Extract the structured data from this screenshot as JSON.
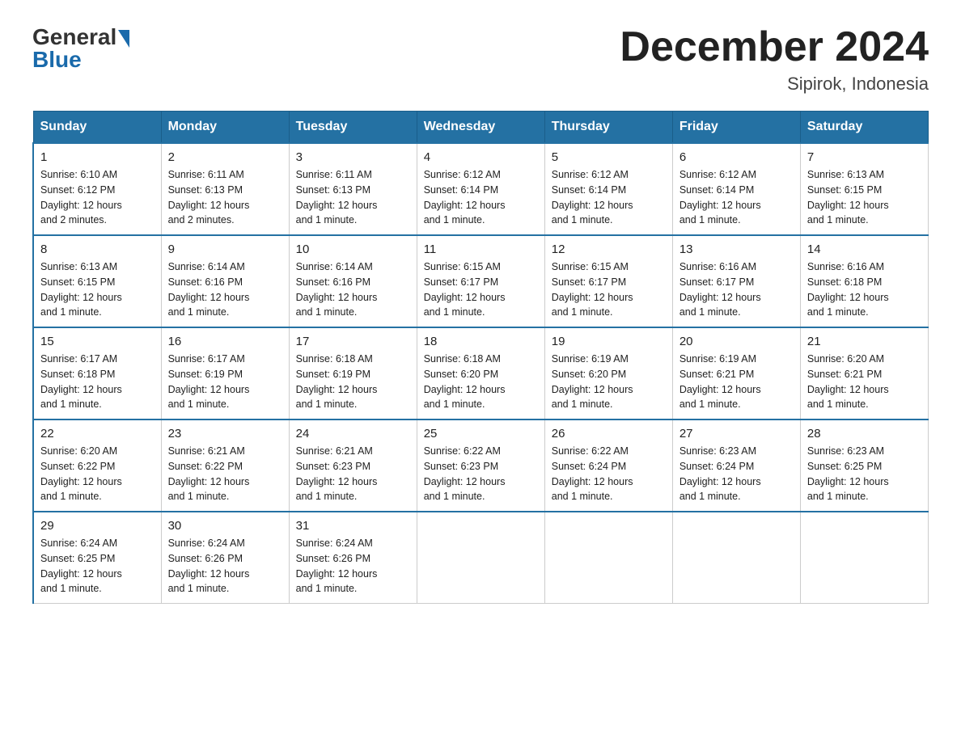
{
  "header": {
    "logo_general": "General",
    "logo_blue": "Blue",
    "month_title": "December 2024",
    "location": "Sipirok, Indonesia"
  },
  "days_of_week": [
    "Sunday",
    "Monday",
    "Tuesday",
    "Wednesday",
    "Thursday",
    "Friday",
    "Saturday"
  ],
  "weeks": [
    [
      {
        "day": "1",
        "sunrise": "6:10 AM",
        "sunset": "6:12 PM",
        "daylight": "12 hours and 2 minutes."
      },
      {
        "day": "2",
        "sunrise": "6:11 AM",
        "sunset": "6:13 PM",
        "daylight": "12 hours and 2 minutes."
      },
      {
        "day": "3",
        "sunrise": "6:11 AM",
        "sunset": "6:13 PM",
        "daylight": "12 hours and 1 minute."
      },
      {
        "day": "4",
        "sunrise": "6:12 AM",
        "sunset": "6:14 PM",
        "daylight": "12 hours and 1 minute."
      },
      {
        "day": "5",
        "sunrise": "6:12 AM",
        "sunset": "6:14 PM",
        "daylight": "12 hours and 1 minute."
      },
      {
        "day": "6",
        "sunrise": "6:12 AM",
        "sunset": "6:14 PM",
        "daylight": "12 hours and 1 minute."
      },
      {
        "day": "7",
        "sunrise": "6:13 AM",
        "sunset": "6:15 PM",
        "daylight": "12 hours and 1 minute."
      }
    ],
    [
      {
        "day": "8",
        "sunrise": "6:13 AM",
        "sunset": "6:15 PM",
        "daylight": "12 hours and 1 minute."
      },
      {
        "day": "9",
        "sunrise": "6:14 AM",
        "sunset": "6:16 PM",
        "daylight": "12 hours and 1 minute."
      },
      {
        "day": "10",
        "sunrise": "6:14 AM",
        "sunset": "6:16 PM",
        "daylight": "12 hours and 1 minute."
      },
      {
        "day": "11",
        "sunrise": "6:15 AM",
        "sunset": "6:17 PM",
        "daylight": "12 hours and 1 minute."
      },
      {
        "day": "12",
        "sunrise": "6:15 AM",
        "sunset": "6:17 PM",
        "daylight": "12 hours and 1 minute."
      },
      {
        "day": "13",
        "sunrise": "6:16 AM",
        "sunset": "6:17 PM",
        "daylight": "12 hours and 1 minute."
      },
      {
        "day": "14",
        "sunrise": "6:16 AM",
        "sunset": "6:18 PM",
        "daylight": "12 hours and 1 minute."
      }
    ],
    [
      {
        "day": "15",
        "sunrise": "6:17 AM",
        "sunset": "6:18 PM",
        "daylight": "12 hours and 1 minute."
      },
      {
        "day": "16",
        "sunrise": "6:17 AM",
        "sunset": "6:19 PM",
        "daylight": "12 hours and 1 minute."
      },
      {
        "day": "17",
        "sunrise": "6:18 AM",
        "sunset": "6:19 PM",
        "daylight": "12 hours and 1 minute."
      },
      {
        "day": "18",
        "sunrise": "6:18 AM",
        "sunset": "6:20 PM",
        "daylight": "12 hours and 1 minute."
      },
      {
        "day": "19",
        "sunrise": "6:19 AM",
        "sunset": "6:20 PM",
        "daylight": "12 hours and 1 minute."
      },
      {
        "day": "20",
        "sunrise": "6:19 AM",
        "sunset": "6:21 PM",
        "daylight": "12 hours and 1 minute."
      },
      {
        "day": "21",
        "sunrise": "6:20 AM",
        "sunset": "6:21 PM",
        "daylight": "12 hours and 1 minute."
      }
    ],
    [
      {
        "day": "22",
        "sunrise": "6:20 AM",
        "sunset": "6:22 PM",
        "daylight": "12 hours and 1 minute."
      },
      {
        "day": "23",
        "sunrise": "6:21 AM",
        "sunset": "6:22 PM",
        "daylight": "12 hours and 1 minute."
      },
      {
        "day": "24",
        "sunrise": "6:21 AM",
        "sunset": "6:23 PM",
        "daylight": "12 hours and 1 minute."
      },
      {
        "day": "25",
        "sunrise": "6:22 AM",
        "sunset": "6:23 PM",
        "daylight": "12 hours and 1 minute."
      },
      {
        "day": "26",
        "sunrise": "6:22 AM",
        "sunset": "6:24 PM",
        "daylight": "12 hours and 1 minute."
      },
      {
        "day": "27",
        "sunrise": "6:23 AM",
        "sunset": "6:24 PM",
        "daylight": "12 hours and 1 minute."
      },
      {
        "day": "28",
        "sunrise": "6:23 AM",
        "sunset": "6:25 PM",
        "daylight": "12 hours and 1 minute."
      }
    ],
    [
      {
        "day": "29",
        "sunrise": "6:24 AM",
        "sunset": "6:25 PM",
        "daylight": "12 hours and 1 minute."
      },
      {
        "day": "30",
        "sunrise": "6:24 AM",
        "sunset": "6:26 PM",
        "daylight": "12 hours and 1 minute."
      },
      {
        "day": "31",
        "sunrise": "6:24 AM",
        "sunset": "6:26 PM",
        "daylight": "12 hours and 1 minute."
      },
      null,
      null,
      null,
      null
    ]
  ],
  "labels": {
    "sunrise": "Sunrise:",
    "sunset": "Sunset:",
    "daylight": "Daylight:"
  }
}
